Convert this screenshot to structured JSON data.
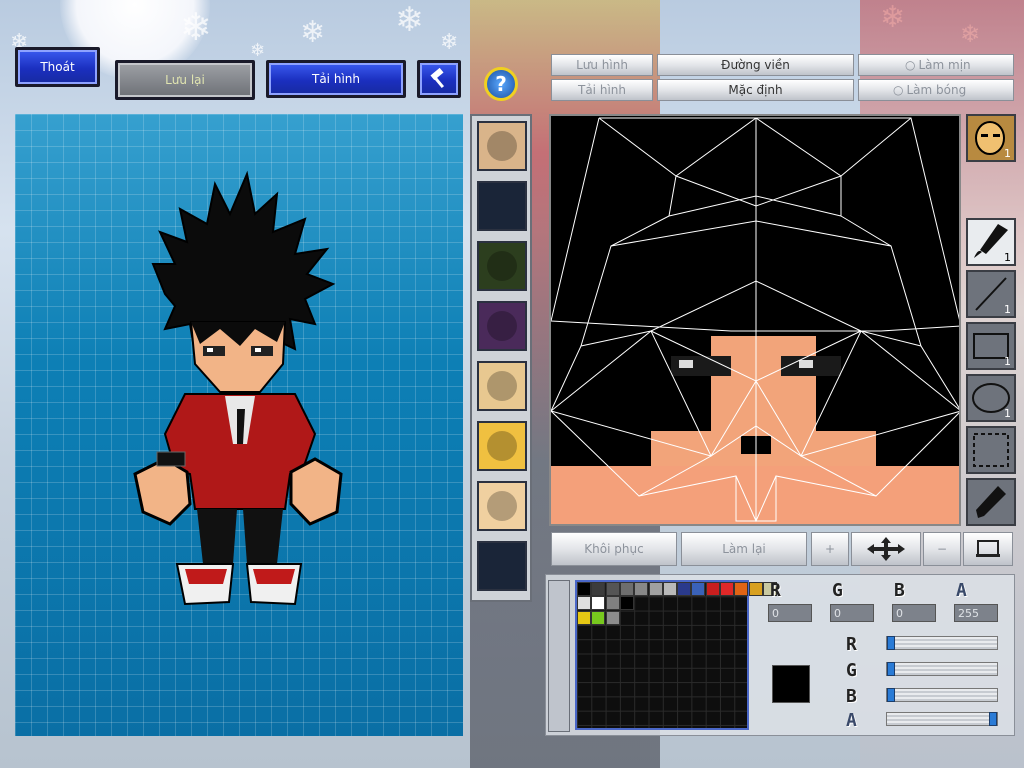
{
  "window": {
    "title": ""
  },
  "topbar": {
    "exit_label": "Thoát",
    "save_label": "Lưu lại",
    "reload_label": "Tải hình",
    "tool_icon": "hammer-icon",
    "help_icon": "question-icon"
  },
  "texture_toolbar": {
    "save_image_label": "Lưu hình",
    "load_image_label": "Tải hình",
    "outline_label": "Đường viền",
    "default_label": "Mặc định",
    "smooth_label": "Làm mịn",
    "shine_label": "Làm bóng"
  },
  "part_slots": [
    {
      "name": "face-portrait",
      "icon": "character-face-icon"
    },
    {
      "name": "empty",
      "icon": ""
    },
    {
      "name": "tree",
      "icon": "tree-icon"
    },
    {
      "name": "purple-outfit",
      "icon": "outfit-icon"
    },
    {
      "name": "closed-eyes-face",
      "icon": "face-icon"
    },
    {
      "name": "yellow-face",
      "icon": "face-icon"
    },
    {
      "name": "plain-face",
      "icon": "face-icon"
    },
    {
      "name": "empty",
      "icon": ""
    }
  ],
  "tools": {
    "head_badge": "1",
    "brush_count": "1",
    "line_count": "1",
    "rect_count": "1",
    "ellipse_count": "1"
  },
  "edit_bar": {
    "restore_label": "Khôi phục",
    "redo_label": "Làm lại"
  },
  "color": {
    "r_label": "R",
    "g_label": "G",
    "b_label": "B",
    "a_label": "A",
    "r_value": "0",
    "g_value": "0",
    "b_value": "0",
    "a_value": "255",
    "current": "#000000",
    "palette_row1": [
      "#000000",
      "#3c3c3c",
      "#555555",
      "#6e6e6e",
      "#888888",
      "#a0a0a0",
      "#b9b9b9",
      "#2a3a8c",
      "#3a62b8",
      "#c81e1e",
      "#e02828",
      "#e06414",
      "#d8a020",
      "#c8c8a0"
    ],
    "palette_row2": [
      "#e0e0e0",
      "#ffffff",
      "#808080",
      "#000000"
    ],
    "palette_row3": [
      "#e6c814",
      "#78c81e",
      "#8c8c8c"
    ]
  }
}
